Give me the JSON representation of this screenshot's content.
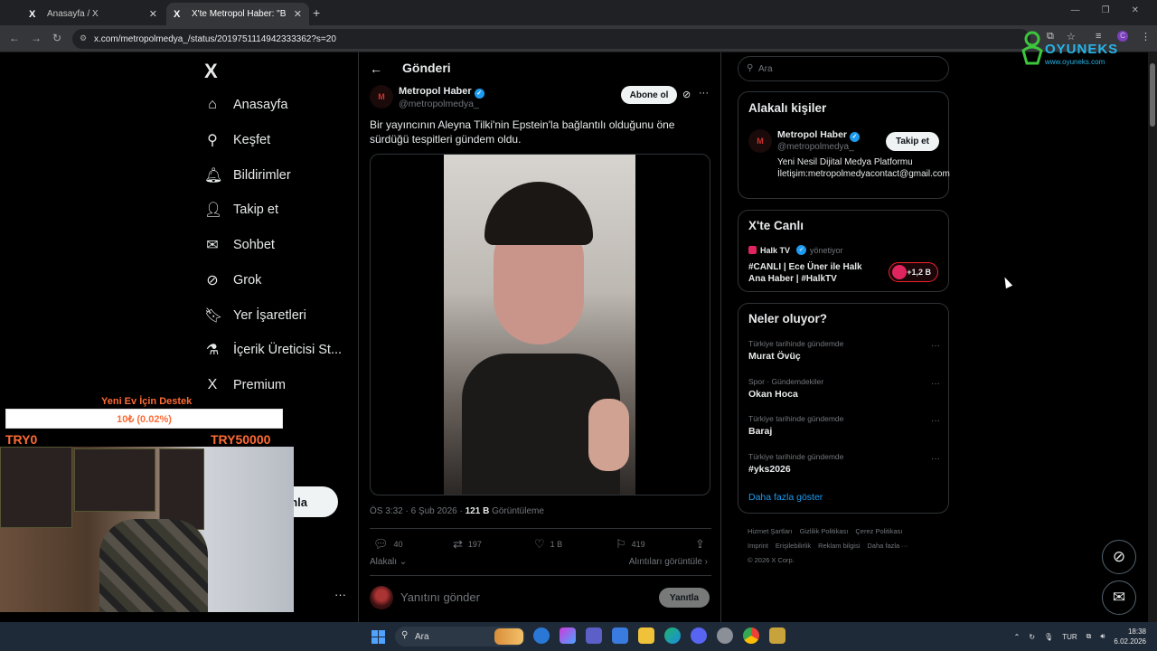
{
  "browser": {
    "tabs": [
      {
        "favicon": "X",
        "title": "Anasayfa / X",
        "close": "✕"
      },
      {
        "favicon": "X",
        "title": "X'te Metropol Haber: \"Bir yayı",
        "close": "✕"
      }
    ],
    "new_tab": "+",
    "url": "x.com/metropolmedya_/status/2019751114942333362?s=20"
  },
  "overlay_logo": {
    "brand": "OYUNEKS",
    "site": "www.oyuneks.com"
  },
  "nav": {
    "logo": "X",
    "items": [
      {
        "label": "Anasayfa",
        "icon": "home-icon",
        "glyph": "⌂"
      },
      {
        "label": "Keşfet",
        "icon": "search-icon",
        "glyph": "⚲"
      },
      {
        "label": "Bildirimler",
        "icon": "bell-icon",
        "glyph": "🔔︎"
      },
      {
        "label": "Takip et",
        "icon": "add-user-icon",
        "glyph": "👤︎"
      },
      {
        "label": "Sohbet",
        "icon": "mail-icon",
        "glyph": "✉"
      },
      {
        "label": "Grok",
        "icon": "grok-icon",
        "glyph": "⊘"
      },
      {
        "label": "Yer İşaretleri",
        "icon": "bookmark-icon",
        "glyph": "🔖︎"
      },
      {
        "label": "İçerik Üreticisi St...",
        "icon": "creator-studio-icon",
        "glyph": "⚗"
      },
      {
        "label": "Premium",
        "icon": "x-premium-icon",
        "glyph": "X"
      }
    ],
    "post_button": "nla",
    "more": "···"
  },
  "donation": {
    "title": "Yeni Ev İçin Destek",
    "progress_text": "10₺ (0.02%)",
    "progress_fraction": 0.0002,
    "min": "TRY0",
    "max": "TRY50000"
  },
  "post": {
    "header_title": "Gönderi",
    "author_name": "Metropol Haber",
    "author_handle": "@metropolmedya_",
    "avatar_text": "M",
    "subscribe_label": "Abone ol",
    "text": "Bir yayıncının Aleyna Tilki'nin Epstein'la bağlantılı olduğunu öne sürdüğü tespitleri gündem oldu.",
    "time": "ÖS 3:32 · 6 Şub 2026 · ",
    "views_count": "121 B",
    "views_label": " Görüntüleme",
    "stats": {
      "replies": "40",
      "reposts": "197",
      "likes": "1 B",
      "bookmarks": "419"
    },
    "relevance_label": "Alakalı ⌄",
    "quotes_label": "Alıntıları görüntüle ›",
    "reply_placeholder": "Yanıtını gönder",
    "reply_button": "Yanıtla"
  },
  "sidebar": {
    "search_placeholder": "Ara",
    "relevant": {
      "title": "Alakalı kişiler",
      "name": "Metropol Haber",
      "handle": "@metropolmedya_",
      "avatar_text": "M",
      "follow_label": "Takip et",
      "bio": "Yeni Nesil Dijital Medya Platformu İletişim:metropolmedyacontact@gmail.com"
    },
    "live": {
      "title": "X'te Canlı",
      "host": "Halk TV",
      "host_suffix": "yönetiyor",
      "stream_title": "#CANLI | Ece Üner ile Halk Ana Haber | #HalkTV",
      "listeners": "+1,2 B"
    },
    "trends": {
      "title": "Neler oluyor?",
      "items": [
        {
          "context": "Türkiye tarihinde gündemde",
          "name": "Murat Övüç"
        },
        {
          "context": "Spor · Gündemdekiler",
          "name": "Okan Hoca"
        },
        {
          "context": "Türkiye tarihinde gündemde",
          "name": "Baraj"
        },
        {
          "context": "Türkiye tarihinde gündemde",
          "name": "#yks2026"
        }
      ],
      "show_more": "Daha fazla göster"
    },
    "footer": {
      "links": [
        "Hizmet Şartları",
        "Gizlilik Politikası",
        "Çerez Politikası",
        "Imprint",
        "Erişilebilirlik",
        "Reklam bilgisi",
        "Daha fazla ···"
      ],
      "copyright": "© 2026 X Corp."
    }
  },
  "taskbar": {
    "search_placeholder": "Ara",
    "language": "TUR",
    "time": "18:38",
    "date": "6.02.2026"
  },
  "colors": {
    "accent": "#1d9bf0",
    "live": "#f4212e",
    "donation": "#ff6b35"
  }
}
